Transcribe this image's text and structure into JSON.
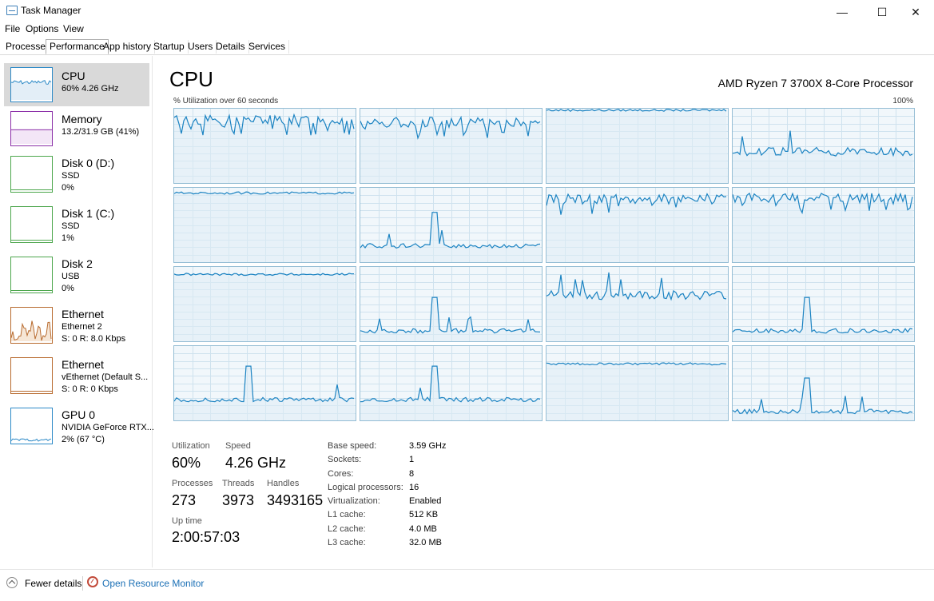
{
  "window": {
    "title": "Task Manager",
    "controls": {
      "minimize": "—",
      "maximize": "☐",
      "close": "✕"
    }
  },
  "menu": [
    "File",
    "Options",
    "View"
  ],
  "tabs": [
    {
      "label": "Processes",
      "active": false
    },
    {
      "label": "Performance",
      "active": true
    },
    {
      "label": "App history",
      "active": false
    },
    {
      "label": "Startup",
      "active": false
    },
    {
      "label": "Users",
      "active": false
    },
    {
      "label": "Details",
      "active": false
    },
    {
      "label": "Services",
      "active": false
    }
  ],
  "sidebar": {
    "items": [
      {
        "title": "CPU",
        "lines": [
          "60%  4.26 GHz"
        ],
        "color": "#2d8ac7",
        "selected": true
      },
      {
        "title": "Memory",
        "lines": [
          "13.2/31.9 GB (41%)"
        ],
        "color": "#8b2fa8",
        "selected": false
      },
      {
        "title": "Disk 0 (D:)",
        "lines": [
          "SSD",
          "0%"
        ],
        "color": "#4ca64c",
        "selected": false
      },
      {
        "title": "Disk 1 (C:)",
        "lines": [
          "SSD",
          "1%"
        ],
        "color": "#4ca64c",
        "selected": false
      },
      {
        "title": "Disk 2",
        "lines": [
          "USB",
          "0%"
        ],
        "color": "#4ca64c",
        "selected": false
      },
      {
        "title": "Ethernet",
        "lines": [
          "Ethernet 2",
          "S: 0  R: 8.0 Kbps"
        ],
        "color": "#b86b2f",
        "selected": false
      },
      {
        "title": "Ethernet",
        "lines": [
          "vEthernet (Default S...",
          "S: 0  R: 0 Kbps"
        ],
        "color": "#b86b2f",
        "selected": false
      },
      {
        "title": "GPU 0",
        "lines": [
          "NVIDIA GeForce RTX...",
          "2%  (67 °C)"
        ],
        "color": "#2d8ac7",
        "selected": false
      }
    ]
  },
  "main": {
    "title": "CPU",
    "cpu_name": "AMD Ryzen 7 3700X 8-Core Processor",
    "caption_left": "% Utilization over 60 seconds",
    "caption_right": "100%",
    "core_graph_colors": {
      "line": "#1b83c2",
      "fill": "#deecf6",
      "grid": "#cfe2ee"
    },
    "core_levels": [
      [
        0.85,
        "high"
      ],
      [
        0.82,
        "high"
      ],
      [
        0.98,
        "flat"
      ],
      [
        0.42,
        "mid"
      ],
      [
        0.93,
        "flat"
      ],
      [
        0.22,
        "low"
      ],
      [
        0.85,
        "high"
      ],
      [
        0.87,
        "high"
      ],
      [
        0.9,
        "flat"
      ],
      [
        0.14,
        "low"
      ],
      [
        0.62,
        "mid"
      ],
      [
        0.14,
        "low"
      ],
      [
        0.28,
        "low"
      ],
      [
        0.28,
        "low"
      ],
      [
        0.76,
        "flat"
      ],
      [
        0.12,
        "low"
      ]
    ],
    "stats": {
      "utilization_label": "Utilization",
      "utilization": "60%",
      "speed_label": "Speed",
      "speed": "4.26 GHz",
      "processes_label": "Processes",
      "processes": "273",
      "threads_label": "Threads",
      "threads": "3973",
      "handles_label": "Handles",
      "handles": "3493165",
      "uptime_label": "Up time",
      "uptime": "2:00:57:03"
    },
    "specs": [
      {
        "label": "Base speed:",
        "value": "3.59 GHz"
      },
      {
        "label": "Sockets:",
        "value": "1"
      },
      {
        "label": "Cores:",
        "value": "8"
      },
      {
        "label": "Logical processors:",
        "value": "16"
      },
      {
        "label": "Virtualization:",
        "value": "Enabled"
      },
      {
        "label": "L1 cache:",
        "value": "512 KB"
      },
      {
        "label": "L2 cache:",
        "value": "4.0 MB"
      },
      {
        "label": "L3 cache:",
        "value": "32.0 MB"
      }
    ]
  },
  "footer": {
    "fewer_details": "Fewer details",
    "resource_monitor": "Open Resource Monitor"
  }
}
